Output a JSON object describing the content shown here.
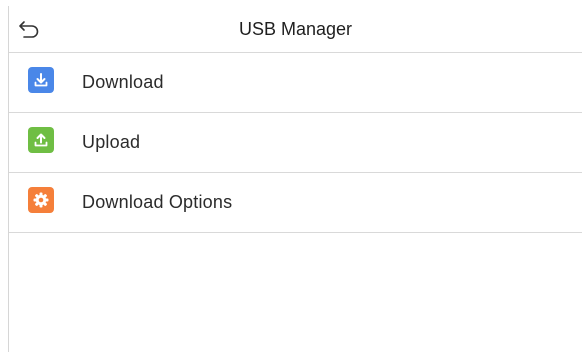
{
  "header": {
    "title": "USB Manager",
    "back_icon": "back-arrow-icon"
  },
  "menu": {
    "items": [
      {
        "label": "Download",
        "icon": "download-icon",
        "color": "#4a87e8"
      },
      {
        "label": "Upload",
        "icon": "upload-icon",
        "color": "#6fbe44"
      },
      {
        "label": "Download Options",
        "icon": "gear-icon",
        "color": "#f57f3a"
      }
    ]
  }
}
